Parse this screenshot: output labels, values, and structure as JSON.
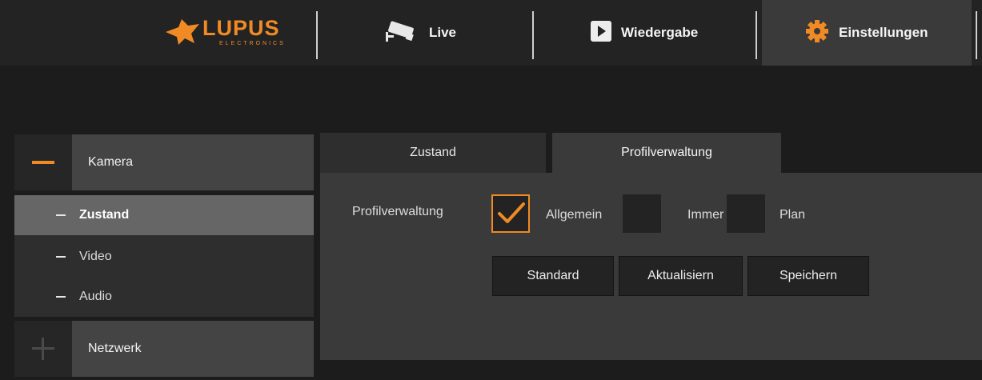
{
  "brand": {
    "name": "LUPUS",
    "sub": "ELECTRONICS",
    "color": "#f08a24"
  },
  "nav": [
    {
      "label": "Live",
      "icon": "camera-icon"
    },
    {
      "label": "Wiedergabe",
      "icon": "play-icon"
    },
    {
      "label": "Einstellungen",
      "icon": "gear-icon",
      "active": true
    }
  ],
  "sidebar": {
    "kamera": {
      "label": "Kamera",
      "expanded": true
    },
    "items": [
      {
        "label": "Zustand",
        "active": true
      },
      {
        "label": "Video"
      },
      {
        "label": "Audio"
      }
    ],
    "netzwerk": {
      "label": "Netzwerk",
      "expanded": false
    }
  },
  "tabs": [
    {
      "label": "Zustand"
    },
    {
      "label": "Profilverwaltung",
      "active": true
    }
  ],
  "panel": {
    "label": "Profilverwaltung",
    "options": [
      {
        "label": "Allgemein",
        "checked": true
      },
      {
        "label": "Immer",
        "checked": false
      },
      {
        "label": "Plan",
        "checked": false
      }
    ],
    "buttons": {
      "standard": "Standard",
      "refresh": "Aktualisiern",
      "save": "Speichern"
    }
  }
}
